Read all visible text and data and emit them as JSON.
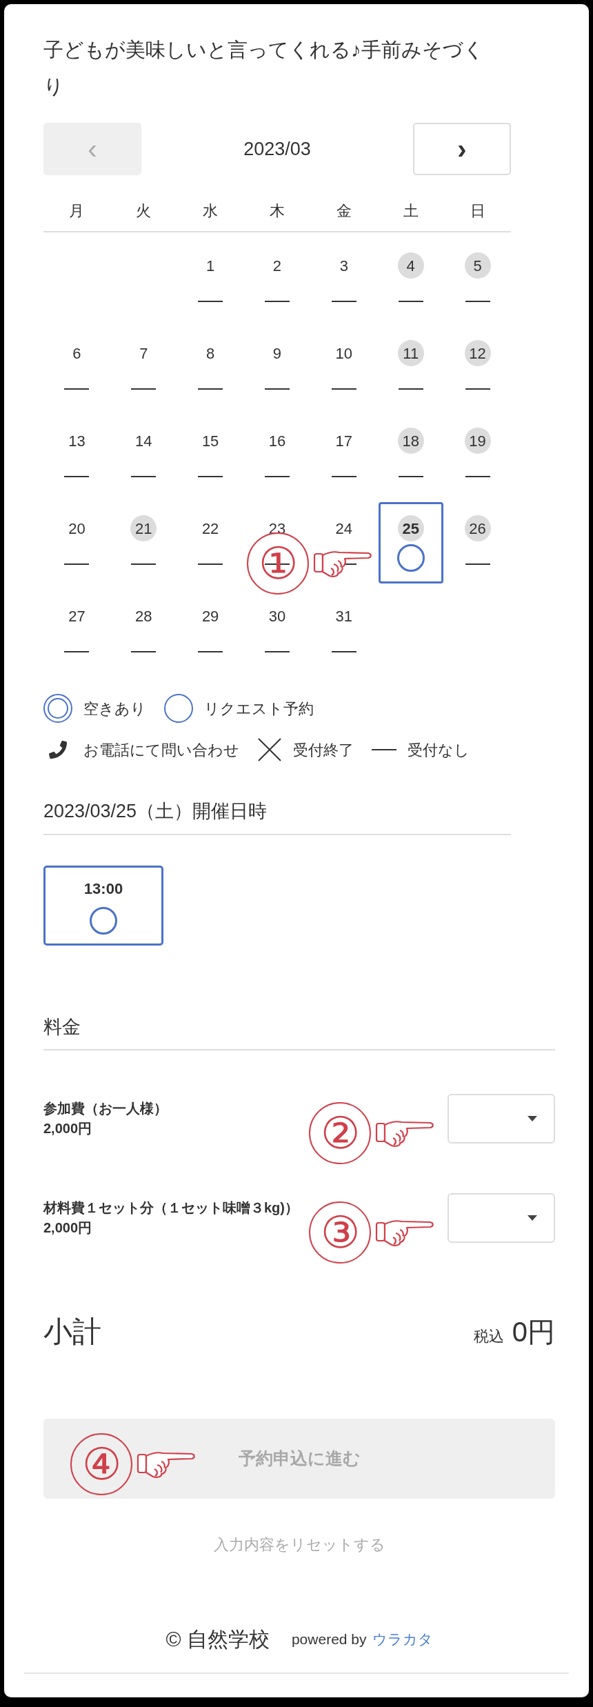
{
  "title": "子どもが美味しいと言ってくれる♪手前みそづくり",
  "calendar": {
    "month": "2023/03",
    "prev": "‹",
    "next": "›",
    "prev_disabled": true,
    "weekdays": [
      "月",
      "火",
      "水",
      "木",
      "金",
      "土",
      "日"
    ],
    "weeks": [
      [
        {
          "kind": "blank"
        },
        {
          "kind": "blank"
        },
        {
          "day": "1",
          "holiday": false,
          "selected": false,
          "kind": "none"
        },
        {
          "day": "2",
          "holiday": false,
          "selected": false,
          "kind": "none"
        },
        {
          "day": "3",
          "holiday": false,
          "selected": false,
          "kind": "none"
        },
        {
          "day": "4",
          "holiday": true,
          "selected": false,
          "kind": "none"
        },
        {
          "day": "5",
          "holiday": true,
          "selected": false,
          "kind": "none"
        }
      ],
      [
        {
          "day": "6",
          "holiday": false,
          "selected": false,
          "kind": "none"
        },
        {
          "day": "7",
          "holiday": false,
          "selected": false,
          "kind": "none"
        },
        {
          "day": "8",
          "holiday": false,
          "selected": false,
          "kind": "none"
        },
        {
          "day": "9",
          "holiday": false,
          "selected": false,
          "kind": "none"
        },
        {
          "day": "10",
          "holiday": false,
          "selected": false,
          "kind": "none"
        },
        {
          "day": "11",
          "holiday": true,
          "selected": false,
          "kind": "none"
        },
        {
          "day": "12",
          "holiday": true,
          "selected": false,
          "kind": "none"
        }
      ],
      [
        {
          "day": "13",
          "holiday": false,
          "selected": false,
          "kind": "none"
        },
        {
          "day": "14",
          "holiday": false,
          "selected": false,
          "kind": "none"
        },
        {
          "day": "15",
          "holiday": false,
          "selected": false,
          "kind": "none"
        },
        {
          "day": "16",
          "holiday": false,
          "selected": false,
          "kind": "none"
        },
        {
          "day": "17",
          "holiday": false,
          "selected": false,
          "kind": "none"
        },
        {
          "day": "18",
          "holiday": true,
          "selected": false,
          "kind": "none"
        },
        {
          "day": "19",
          "holiday": true,
          "selected": false,
          "kind": "none"
        }
      ],
      [
        {
          "day": "20",
          "holiday": false,
          "selected": false,
          "kind": "none"
        },
        {
          "day": "21",
          "holiday": true,
          "selected": false,
          "kind": "none"
        },
        {
          "day": "22",
          "holiday": false,
          "selected": false,
          "kind": "none"
        },
        {
          "day": "23",
          "holiday": false,
          "selected": false,
          "kind": "none"
        },
        {
          "day": "24",
          "holiday": false,
          "selected": false,
          "kind": "none"
        },
        {
          "day": "25",
          "holiday": true,
          "selected": true,
          "kind": "request"
        },
        {
          "day": "26",
          "holiday": true,
          "selected": false,
          "kind": "none"
        }
      ],
      [
        {
          "day": "27",
          "holiday": false,
          "selected": false,
          "kind": "none"
        },
        {
          "day": "28",
          "holiday": false,
          "selected": false,
          "kind": "none"
        },
        {
          "day": "29",
          "holiday": false,
          "selected": false,
          "kind": "none"
        },
        {
          "day": "30",
          "holiday": false,
          "selected": false,
          "kind": "none"
        },
        {
          "day": "31",
          "holiday": false,
          "selected": false,
          "kind": "none"
        },
        {
          "kind": "blank"
        },
        {
          "kind": "blank"
        }
      ]
    ]
  },
  "legend": [
    [
      {
        "kind": "available",
        "label": "空きあり"
      },
      {
        "kind": "request",
        "label": "リクエスト予約"
      }
    ],
    [
      {
        "kind": "phone",
        "label": "お電話にて問い合わせ"
      },
      {
        "kind": "closed",
        "label": "受付終了"
      },
      {
        "kind": "none",
        "label": "受付なし"
      }
    ]
  ],
  "schedule": {
    "heading": "2023/03/25（土）開催日時",
    "slots": [
      {
        "time": "13:00",
        "selected": true,
        "kind": "request"
      }
    ]
  },
  "fees": {
    "heading": "料金",
    "items": [
      {
        "name": "参加費（お一人様）",
        "price": "2,000円"
      },
      {
        "name": "材料費１セット分（１セット味噌３kg)）",
        "price": "2,000円"
      }
    ]
  },
  "subtotal": {
    "label": "小計",
    "tax": "税込",
    "amount": "0円"
  },
  "submit": {
    "label": "予約申込に進む",
    "disabled": true
  },
  "reset": "入力内容をリセットする",
  "footer": {
    "copyright": "© 自然学校",
    "powered": "powered by",
    "brand": "ウラカタ"
  },
  "annotations": [
    "①",
    "②",
    "③",
    "④"
  ]
}
